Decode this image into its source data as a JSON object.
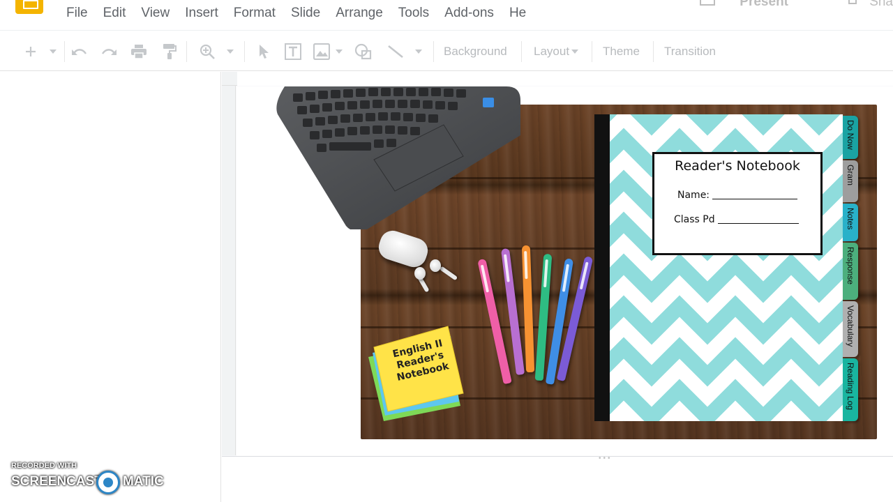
{
  "menubar": {
    "items": [
      "File",
      "Edit",
      "View",
      "Insert",
      "Format",
      "Slide",
      "Arrange",
      "Tools",
      "Add-ons",
      "He"
    ],
    "present_label": "Present",
    "share_label": "Sha"
  },
  "toolbar": {
    "background_label": "Background",
    "layout_label": "Layout",
    "theme_label": "Theme",
    "transition_label": "Transition",
    "icons": [
      "new-slide-icon",
      "undo-icon",
      "redo-icon",
      "print-icon",
      "paint-format-icon",
      "zoom-icon",
      "select-icon",
      "text-box-icon",
      "image-icon",
      "shape-icon",
      "line-icon"
    ]
  },
  "slide": {
    "sticky_note": "English II Reader's Notebook",
    "notebook_title": "Reader's Notebook",
    "name_label": "Name:",
    "class_label": "Class Pd",
    "tabs": [
      {
        "label": "Do Now",
        "color": "#1aa3a3"
      },
      {
        "label": "Gram",
        "color": "#9e9e9e"
      },
      {
        "label": "Notes",
        "color": "#29b1c9"
      },
      {
        "label": "Response",
        "color": "#4caf7d"
      },
      {
        "label": "Vocabulary",
        "color": "#b0b0b0"
      },
      {
        "label": "Reading Log",
        "color": "#19b5a0"
      }
    ],
    "chevron_color": "#8fdcdc"
  },
  "watermark": {
    "line1": "RECORDED WITH",
    "left": "SCREENCAST",
    "right": "MATIC"
  }
}
